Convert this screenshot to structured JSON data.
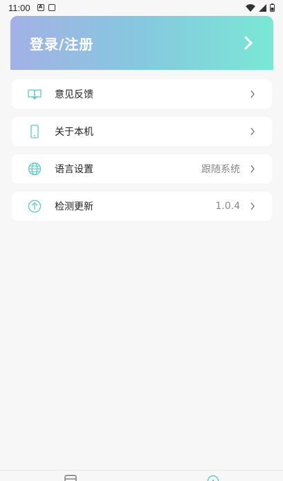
{
  "status_bar": {
    "time": "11:00",
    "left_icons": [
      "a-badge-icon",
      "cast-icon"
    ],
    "right_icons": [
      "wifi-icon",
      "signal-icon",
      "battery-icon"
    ]
  },
  "login": {
    "label": "登录/注册"
  },
  "menu": [
    {
      "id": "feedback",
      "label": "意见反馈",
      "value": "",
      "icon": "book-open-icon"
    },
    {
      "id": "about",
      "label": "关于本机",
      "value": "",
      "icon": "phone-icon"
    },
    {
      "id": "language",
      "label": "语言设置",
      "value": "跟随系统",
      "icon": "globe-icon"
    },
    {
      "id": "update",
      "label": "检测更新",
      "value": "1.0.4",
      "icon": "arrow-up-circle-icon"
    }
  ],
  "colors": {
    "accent": "#5fc8c8",
    "gradient_start": "#a3b1e6",
    "gradient_end": "#7ae8d5"
  },
  "bottom_nav": {
    "tabs": [
      "home-tab-icon",
      "mine-tab-icon"
    ]
  }
}
